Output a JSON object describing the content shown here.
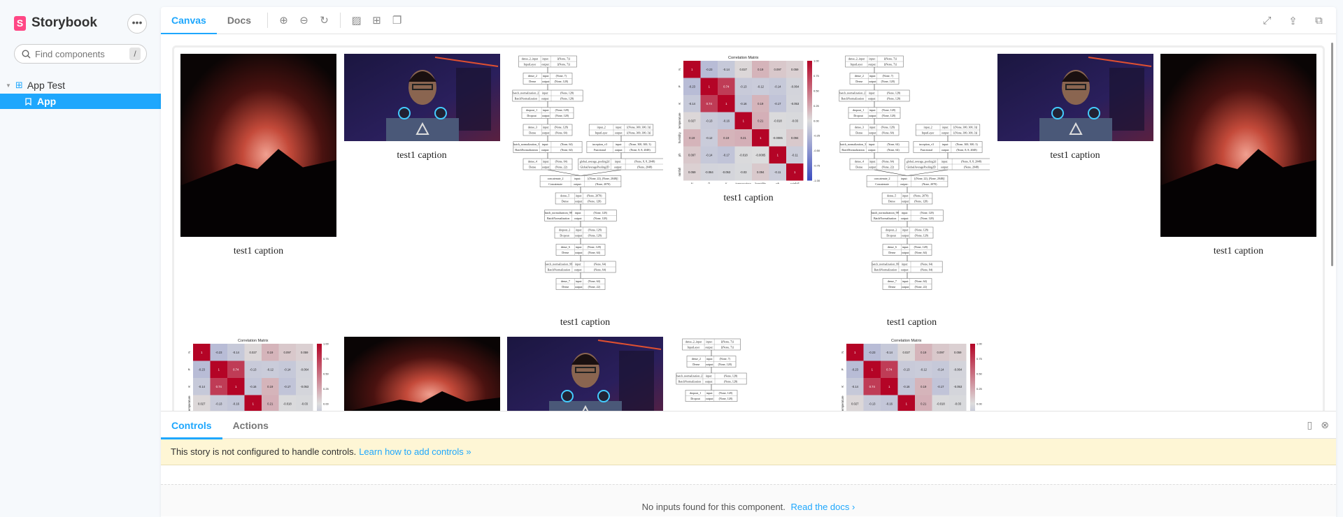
{
  "sidebar": {
    "brand": "Storybook",
    "more": "•••",
    "search_placeholder": "Find components",
    "search_shortcut": "/",
    "group": "App Test",
    "item": "App"
  },
  "toolbar": {
    "tabs": [
      "Canvas",
      "Docs"
    ],
    "active_tab": "Canvas",
    "tools": [
      "zoom-in-icon",
      "zoom-out-icon",
      "zoom-reset-icon",
      "background-icon",
      "grid-icon",
      "outline-icon"
    ],
    "right_tools": [
      "fullscreen-icon",
      "share-icon",
      "copy-icon"
    ]
  },
  "gallery": {
    "items": [
      {
        "kind": "sunset",
        "caption": "test1 caption"
      },
      {
        "kind": "person",
        "caption": "test1 caption"
      },
      {
        "kind": "diagram",
        "caption": "test1 caption"
      },
      {
        "kind": "heatmap",
        "caption": "test1 caption"
      },
      {
        "kind": "diagram",
        "caption": "test1 caption"
      },
      {
        "kind": "person",
        "caption": "test1 caption"
      },
      {
        "kind": "sunset",
        "caption": "test1 caption"
      },
      {
        "kind": "heatmap"
      },
      {
        "kind": "sunset-wide"
      },
      {
        "kind": "person"
      },
      {
        "kind": "diagram"
      },
      {
        "kind": "heatmap"
      }
    ],
    "heatmap": {
      "title": "Correlation Matrix",
      "labels": [
        "N",
        "P",
        "K",
        "temperature",
        "humidity",
        "ph",
        "rainfall"
      ],
      "matrix": [
        [
          1,
          -0.23,
          -0.14,
          0.027,
          0.19,
          0.097,
          0.059
        ],
        [
          -0.23,
          1,
          0.74,
          -0.13,
          -0.12,
          -0.14,
          -0.064
        ],
        [
          -0.14,
          0.74,
          1,
          -0.16,
          0.19,
          -0.17,
          -0.053
        ],
        [
          0.027,
          -0.13,
          -0.16,
          1,
          0.21,
          -0.018,
          -0.03
        ],
        [
          0.19,
          -0.12,
          0.19,
          0.21,
          1,
          -0.0085,
          0.094
        ],
        [
          0.097,
          -0.14,
          -0.17,
          -0.018,
          -0.0085,
          1,
          -0.11
        ],
        [
          0.059,
          -0.064,
          -0.053,
          -0.03,
          0.094,
          -0.11,
          1
        ]
      ],
      "colorbar_ticks": [
        "1.00",
        "0.75",
        "0.50",
        "0.25",
        "0.00",
        "-0.25",
        "-0.50",
        "-0.75",
        "-1.00"
      ],
      "colors": {
        "low": "#3b4cc0",
        "mid": "#dddddd",
        "high": "#b40426"
      }
    },
    "diagram": {
      "left": [
        [
          "dense_2_input",
          "InputLayer",
          "[(None, 7)]",
          "[(None, 7)]"
        ],
        [
          "dense_2",
          "Dense",
          "(None, 7)",
          "(None, 128)"
        ],
        [
          "batch_normalization_2",
          "BatchNormalization",
          "(None, 128)",
          "(None, 128)"
        ],
        [
          "dropout_1",
          "Dropout",
          "(None, 128)",
          "(None, 128)"
        ],
        [
          "dense_3",
          "Dense",
          "(None, 128)",
          "(None, 64)"
        ],
        [
          "batch_normalization_3",
          "BatchNormalization",
          "(None, 64)",
          "(None, 64)"
        ],
        [
          "dense_4",
          "Dense",
          "(None, 64)",
          "(None, 22)"
        ]
      ],
      "right": [
        [
          "input_2",
          "InputLayer",
          "[(None, 300, 300, 3)]",
          "[(None, 300, 300, 3)]"
        ],
        [
          "inception_v3",
          "Functional",
          "(None, 300, 300, 3)",
          "(None, 8, 8, 2048)"
        ],
        [
          "global_average_pooling2d",
          "GlobalAveragePooling2D",
          "(None, 8, 8, 2048)",
          "(None, 2048)"
        ]
      ],
      "bottom": [
        [
          "concatenate_2",
          "Concatenate",
          "[(None, 22), (None, 2048)]",
          "(None, 2070)"
        ],
        [
          "dense_5",
          "Dense",
          "(None, 2070)",
          "(None, 128)"
        ],
        [
          "batch_normalization_98",
          "BatchNormalization",
          "(None, 128)",
          "(None, 128)"
        ],
        [
          "dropout_2",
          "Dropout",
          "(None, 128)",
          "(None, 128)"
        ],
        [
          "dense_6",
          "Dense",
          "(None, 128)",
          "(None, 64)"
        ],
        [
          "batch_normalization_99",
          "BatchNormalization",
          "(None, 64)",
          "(None, 64)"
        ],
        [
          "dense_7",
          "Dense",
          "(None, 64)",
          "(None, 22)"
        ]
      ],
      "input_label": "input:",
      "output_label": "output:"
    }
  },
  "addons": {
    "tabs": [
      "Controls",
      "Actions"
    ],
    "notice": "This story is not configured to handle controls.",
    "notice_link": "Learn how to add controls »",
    "empty": "No inputs found for this component.",
    "empty_link": "Read the docs ›"
  }
}
